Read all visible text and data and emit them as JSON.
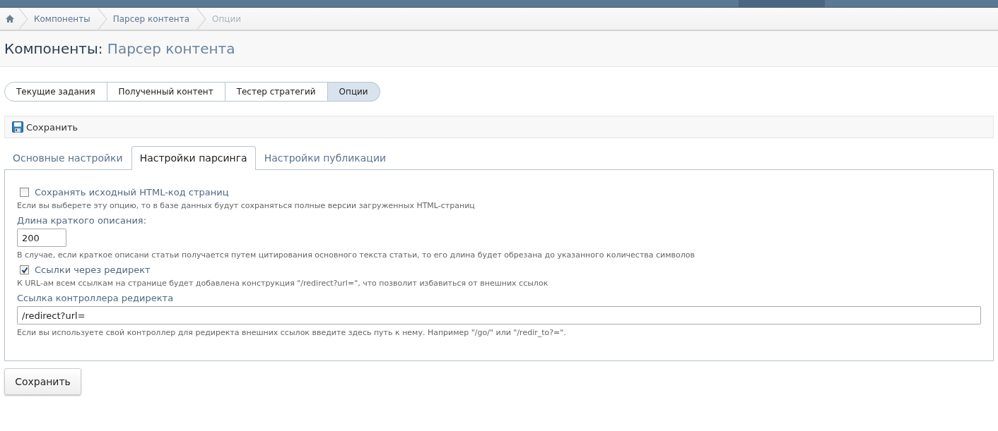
{
  "breadcrumbs": [
    {
      "label": "Компоненты",
      "current": false
    },
    {
      "label": "Парсер контента",
      "current": false
    },
    {
      "label": "Опции",
      "current": true
    }
  ],
  "heading": {
    "prefix": "Компоненты:",
    "title": "Парсер контента"
  },
  "tabs": [
    {
      "label": "Текущие задания",
      "selected": false
    },
    {
      "label": "Полученный контент",
      "selected": false
    },
    {
      "label": "Тестер стратегий",
      "selected": false
    },
    {
      "label": "Опции",
      "selected": true
    }
  ],
  "toolbar": {
    "save": "Сохранить"
  },
  "settings_tabs": [
    {
      "label": "Основные настройки",
      "selected": false
    },
    {
      "label": "Настройки парсинга",
      "selected": true
    },
    {
      "label": "Настройки публикации",
      "selected": false
    }
  ],
  "options": [
    {
      "kind": "checkbox",
      "label": "Сохранять исходный HTML-код страниц",
      "checked": false,
      "hint": "Если вы выберете эту опцию, то в базе данных будут сохраняться полные версии загруженных HTML-страниц"
    },
    {
      "kind": "short",
      "label": "Длина краткого описания:",
      "value": "200",
      "hint": "В случае, если краткое описани статьи получается путем цитирования основного текста статьи, то его длина будет обрезана до указанного количества символов"
    },
    {
      "kind": "checkbox",
      "label": "Ссылки через редирект",
      "checked": true,
      "hint": "К URL-ам всем ссылкам на странице будет добавлена конструкция \"/redirect?url=\", что позволит избавиться от внешних ссылок"
    },
    {
      "kind": "wide",
      "label": "Ссылка контроллера редиректа",
      "value": "/redirect?url=",
      "hint": "Если вы используете свой контроллер для редиректа внешних ссылок введите здесь путь к нему. Например \"/go/\" или \"/redir_to?=\"."
    }
  ],
  "save_button": "Сохранить"
}
